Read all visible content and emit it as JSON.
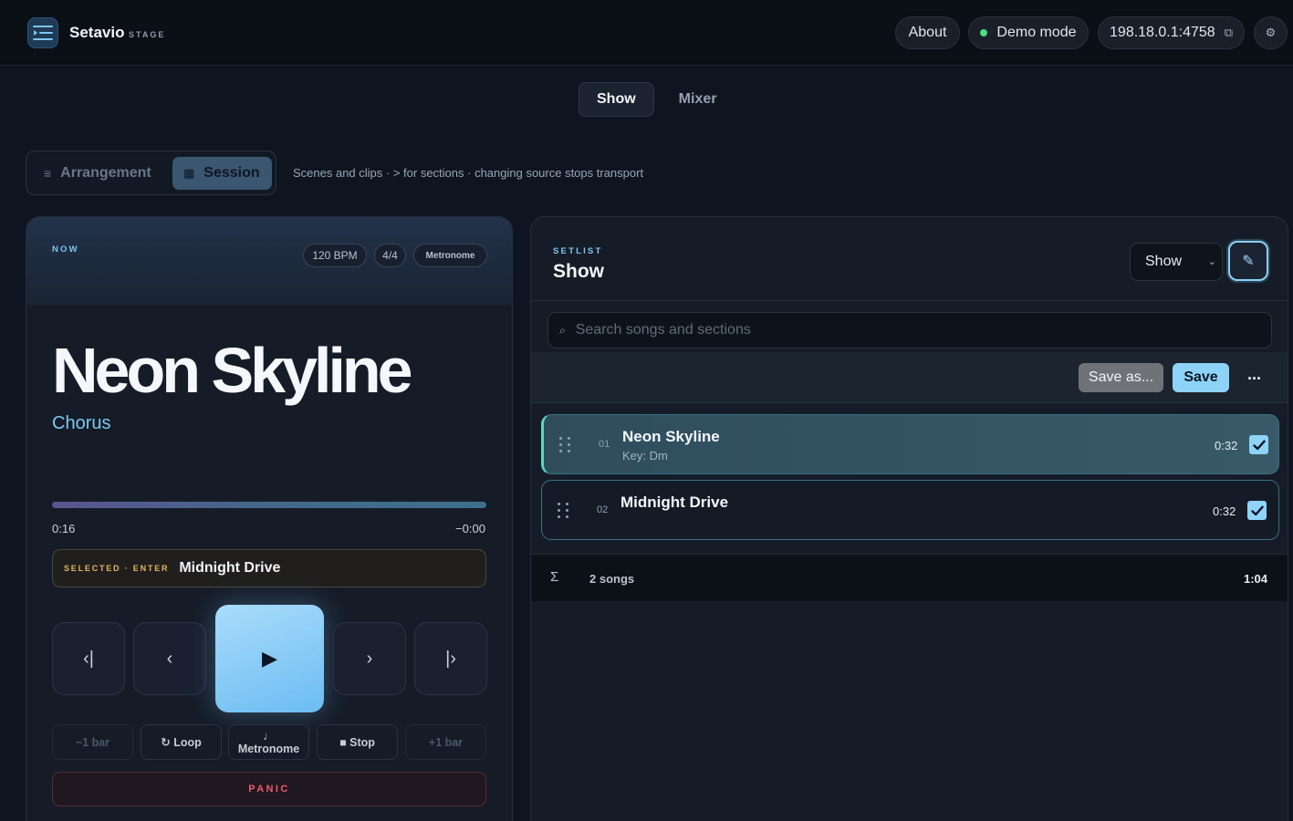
{
  "app": {
    "name": "Setavio",
    "sub": "STAGE"
  },
  "topbar": {
    "about": "About",
    "mode": "Demo mode",
    "address": "198.18.0.1:4758",
    "copy_icon": "⧉",
    "settings_icon": "⚙"
  },
  "tabs": [
    {
      "label": "Show",
      "active": true
    },
    {
      "label": "Mixer",
      "active": false
    }
  ],
  "view_mode": {
    "arrangement": "Arrangement",
    "session": "Session",
    "active": "Session",
    "hint": "Scenes and clips · > for sections · changing source stops transport"
  },
  "now": {
    "eyebrow": "NOW",
    "bpm": "120 BPM",
    "signature": "4/4",
    "metronome": "Metronome",
    "song": "Neon Skyline",
    "section": "Chorus",
    "progress": 1.0,
    "elapsed": "0:16",
    "remaining": "−0:00",
    "selected_tag": "SELECTED · ENTER",
    "selected_song": "Midnight Drive",
    "transport": {
      "prev_song_icon": "‹|",
      "prev_section_icon": "‹",
      "play_icon": "▶",
      "next_section_icon": "›",
      "next_song_icon": "|›"
    },
    "buttons": {
      "minus_bar": "−1 bar",
      "loop": "↻ Loop",
      "metronome_note": "♩",
      "metronome": "Metronome",
      "stop": "■ Stop",
      "plus_bar": "+1 bar"
    },
    "panic": "PANIC"
  },
  "setlist": {
    "eyebrow": "SETLIST",
    "title": "Show",
    "select_value": "Show",
    "edit_icon": "✎",
    "search_icon": "⌕",
    "search_placeholder": "Search songs and sections",
    "save_as": "Save as...",
    "save": "Save",
    "more": "...",
    "songs": [
      {
        "num": "01",
        "name": "Neon Skyline",
        "key": "Key: Dm",
        "duration": "0:32",
        "checked": true,
        "active": true
      },
      {
        "num": "02",
        "name": "Midnight Drive",
        "key": "",
        "duration": "0:32",
        "checked": true,
        "active": false
      }
    ],
    "summary": {
      "sigma": "Σ",
      "count": "2 songs",
      "total": "1:04"
    }
  }
}
